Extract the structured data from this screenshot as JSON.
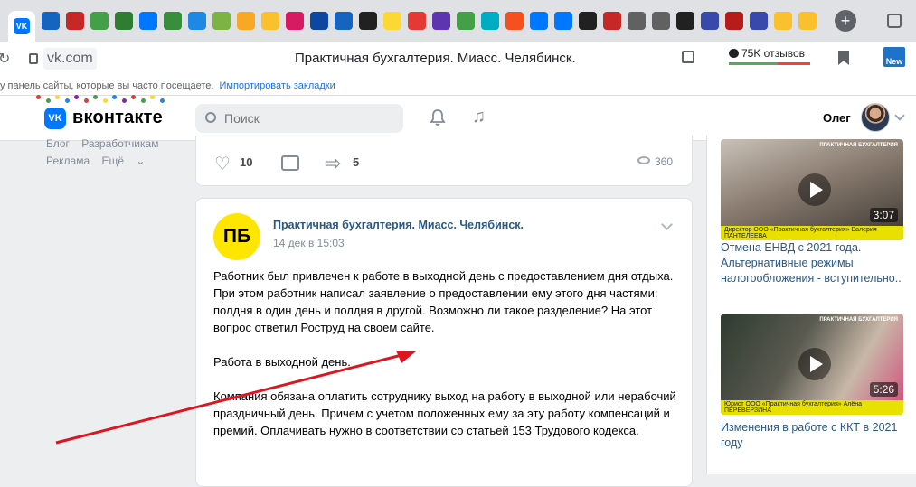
{
  "browser": {
    "url": "vk.com",
    "page_title": "Практичная бухгалтерия. Миасс. Челябинск.",
    "reviews_label": "75K отзывов",
    "new_badge": "New",
    "bookmark_hint": "у панель сайты, которые вы часто посещаете.",
    "import_bookmarks": "Импортировать закладки",
    "tab_icons": [
      "vk",
      "shield",
      "code",
      "leaf",
      "cf",
      "vk",
      "g",
      "s",
      "globe",
      "pen",
      "pin",
      "ig",
      "wp",
      "dot",
      "DA",
      "ПБ",
      "pencil",
      "php",
      "leaf",
      "C",
      "flower",
      "vk",
      "vk",
      "S",
      "X",
      "check",
      "check",
      "</>",
      "wp",
      "wp",
      "wp",
      "coin",
      "coin"
    ]
  },
  "vk": {
    "logo_text": "вконтакте",
    "search_placeholder": "Поиск",
    "user_name": "Олег",
    "left_links": [
      "Блог",
      "Разработчикам",
      "Реклама",
      "Ещё"
    ]
  },
  "prev_post": {
    "likes": "10",
    "shares": "5",
    "views": "360"
  },
  "post": {
    "avatar_text": "ПБ",
    "group_name": "Практичная бухгалтерия. Миасс. Челябинск.",
    "date": "14 дек в 15:03",
    "paragraphs": [
      "Работник был привлечен к работе в выходной день с предоставлением дня отдыха. При этом работник написал заявление о предоставлении ему этого дня частями: полдня в один день и полдня в другой. Возможно ли такое разделение? На этот вопрос ответил Роструд на своем сайте.",
      "Работа в выходной день.",
      "Компания обязана оплатить сотруднику выход на работу в выходной или нерабочий праздничный день. Причем с учетом положенных ему за эту работу компенсаций и премий. Оплачивать нужно в соответствии со статьей 153 Трудового кодекса."
    ]
  },
  "sidebar_videos": [
    {
      "duration": "3:07",
      "title": "Отмена ЕНВД с 2021 года. Альтернативные режимы налогообложения - вступительно..",
      "caption": "Директор ООО «Практичная бухгалтерия» Валерия ПАНТЕЛЕЕВА",
      "brand": "ПРАКТИЧНАЯ БУХГАЛТЕРИЯ"
    },
    {
      "duration": "5:26",
      "title": "Изменения в работе с ККТ в 2021 году",
      "caption": "Юрист ООО «Практичная бухгалтерия» Алёна ПЕРЕВЕРЗИНА",
      "brand": "ПРАКТИЧНАЯ БУХГАЛТЕРИЯ"
    }
  ],
  "colors": {
    "vk_blue": "#0077ff",
    "link": "#2a5885",
    "arrow": "#e0141e",
    "pb_yellow": "#ffe600"
  }
}
